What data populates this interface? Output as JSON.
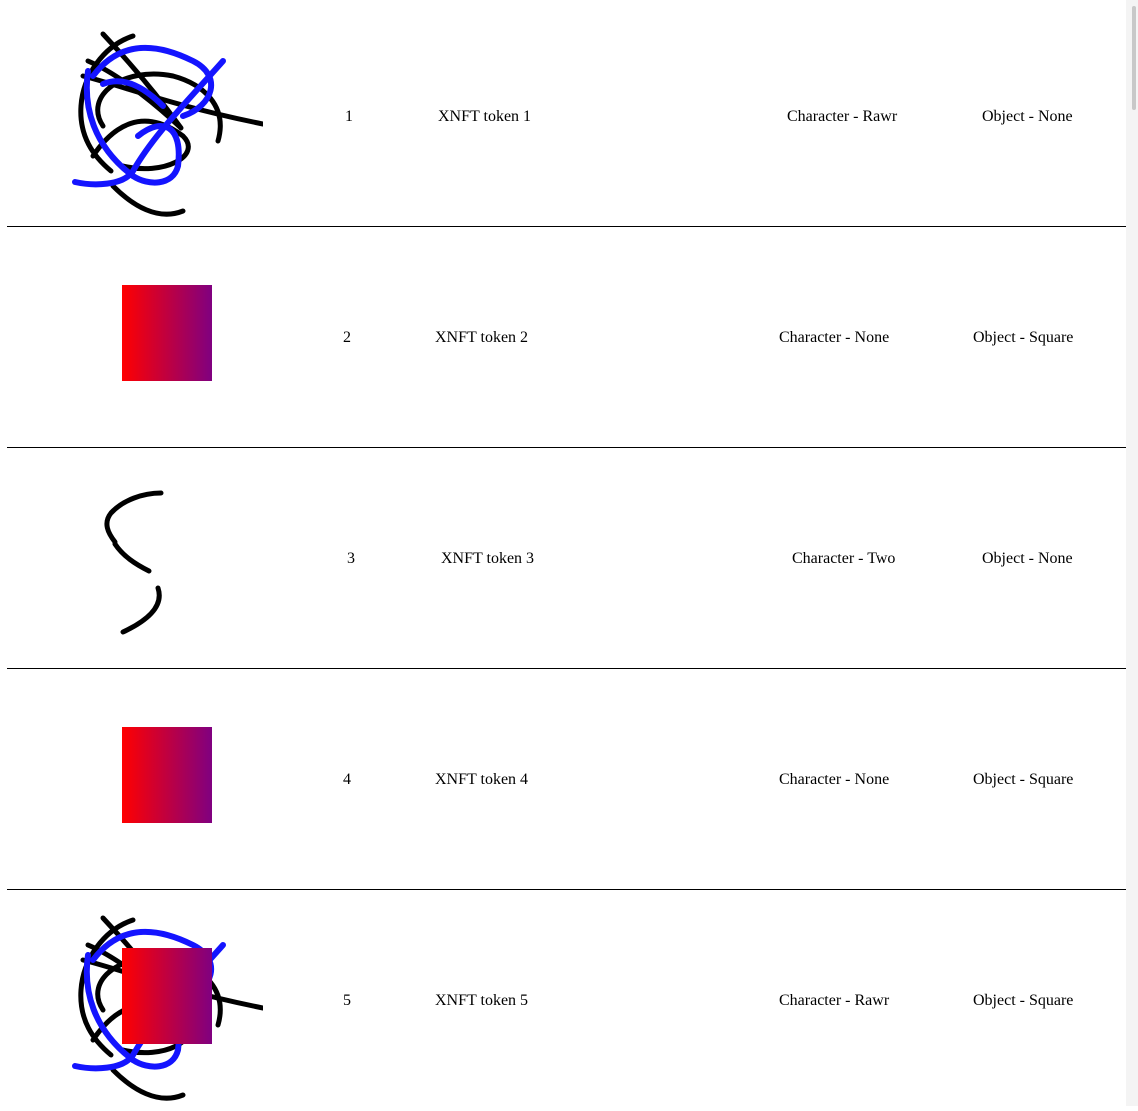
{
  "tokens": [
    {
      "id": "1",
      "name": "XNFT token 1",
      "character": "Character - Rawr",
      "object": "Object - None",
      "image": "scribble-rawr"
    },
    {
      "id": "2",
      "name": "XNFT token 2",
      "character": "Character - None",
      "object": "Object - Square",
      "image": "gradient-square"
    },
    {
      "id": "3",
      "name": "XNFT token 3",
      "character": "Character - Two",
      "object": "Object - None",
      "image": "two-curve"
    },
    {
      "id": "4",
      "name": "XNFT token 4",
      "character": "Character - None",
      "object": "Object - Square",
      "image": "gradient-square"
    },
    {
      "id": "5",
      "name": "XNFT token 5",
      "character": "Character - Rawr",
      "object": "Object - Square",
      "image": "scribble-rawr-with-square"
    }
  ],
  "colors": {
    "gradient_start": "#ff0000",
    "gradient_end": "#800080",
    "scribble_blue": "#1414ff",
    "stroke_black": "#000000"
  }
}
